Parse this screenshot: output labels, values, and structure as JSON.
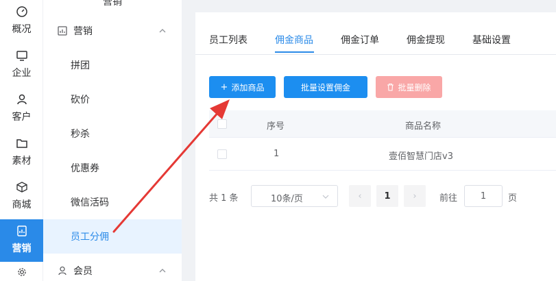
{
  "rail": {
    "items": [
      {
        "label": "概况",
        "icon": "dashboard-icon"
      },
      {
        "label": "企业",
        "icon": "monitor-icon"
      },
      {
        "label": "客户",
        "icon": "user-icon"
      },
      {
        "label": "素材",
        "icon": "folder-icon"
      },
      {
        "label": "商城",
        "icon": "cube-icon"
      },
      {
        "label": "营销",
        "icon": "marketing-icon"
      }
    ],
    "active_color": "#2a8ae8"
  },
  "submenu": {
    "top_cut_label": "营销",
    "group_marketing": "营销",
    "items": [
      "拼团",
      "砍价",
      "秒杀",
      "优惠券",
      "微信活码",
      "员工分佣"
    ],
    "active_item": "员工分佣",
    "group_member": "会员"
  },
  "tabs": [
    "员工列表",
    "佣金商品",
    "佣金订单",
    "佣金提现",
    "基础设置"
  ],
  "active_tab": "佣金商品",
  "buttons": {
    "add": "添加商品",
    "batch_set": "批量设置佣金",
    "batch_delete": "批量删除"
  },
  "table": {
    "headers": {
      "index": "序号",
      "name": "商品名称"
    },
    "rows": [
      {
        "index": "1",
        "name": "壹佰智慧门店v3"
      }
    ]
  },
  "pager": {
    "total": "共 1 条",
    "page_size": "10条/页",
    "current_page": "1",
    "goto_label": "前往",
    "goto_value": "1",
    "page_suffix": "页"
  },
  "colors": {
    "primary": "#1c8ef0",
    "danger_disabled": "#f9a7a7",
    "annotation_arrow": "#e53935"
  }
}
